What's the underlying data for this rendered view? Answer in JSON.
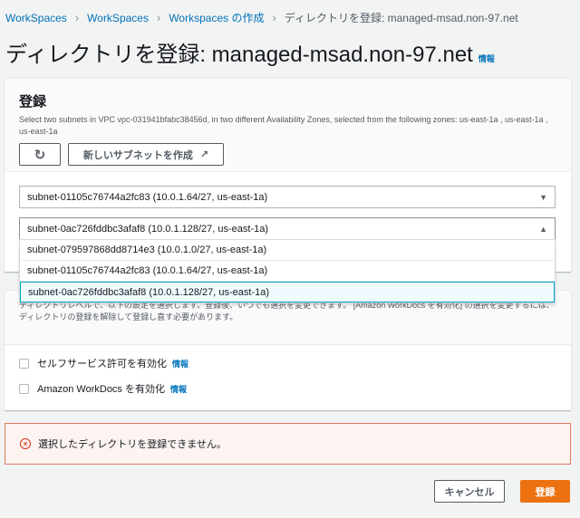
{
  "breadcrumb": [
    "WorkSpaces",
    "WorkSpaces",
    "Workspaces の作成",
    "ディレクトリを登録: managed-msad.non-97.net"
  ],
  "title": "ディレクトリを登録: managed-msad.non-97.net",
  "info": "情報",
  "register_panel": {
    "heading": "登録",
    "description": "Select two subnets in VPC vpc-031941bfabc38456d, in two different Availability Zones, selected from the following zones: us-east-1a , us-east-1a , us-east-1a",
    "refresh_icon": "refresh-icon",
    "create_subnet_label": "新しいサブネットを作成",
    "subnet1": "subnet-01105c76744a2fc83 (10.0.1.64/27, us-east-1a)",
    "subnet2": "subnet-0ac726fddbc3afaf8 (10.0.1.128/27, us-east-1a)",
    "options": [
      "subnet-079597868dd8714e3 (10.0.1.0/27, us-east-1a)",
      "subnet-01105c76744a2fc83 (10.0.1.64/27, us-east-1a)",
      "subnet-0ac726fddbc3afaf8 (10.0.1.128/27, us-east-1a)"
    ]
  },
  "settings_panel": {
    "description": "ディレクトリレベルで、以下の設定を選択します。登録後、いつでも選択を変更できます。 [Amazon WorkDocs を有効化] の選択を変更するには、ディレクトリの登録を解除して登録し直す必要があります。",
    "self_service": "セルフサービス許可を有効化",
    "workdocs": "Amazon WorkDocs を有効化"
  },
  "error": "選択したディレクトリを登録できません。",
  "cancel": "キャンセル",
  "submit": "登録",
  "colors": {
    "accent": "#ec7211",
    "link": "#0073bb",
    "error": "#d13212"
  }
}
